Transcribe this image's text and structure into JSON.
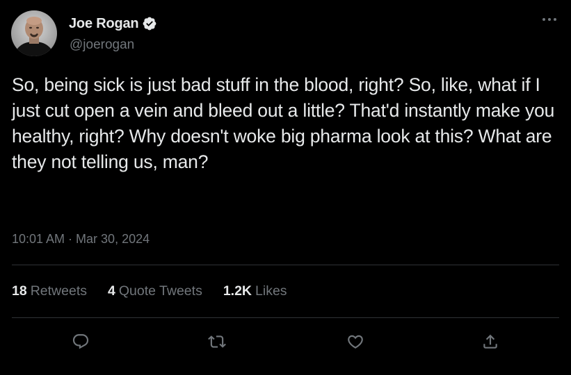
{
  "author": {
    "display_name": "Joe Rogan",
    "handle": "@joerogan",
    "verified": true
  },
  "tweet": {
    "text": "So, being sick is just bad stuff in the blood, right? So, like, what if I just cut open a vein and bleed out a little? That'd instantly make you healthy, right? Why doesn't woke big pharma look at this? What are they not telling us, man?",
    "timestamp": "10:01 AM · Mar 30, 2024"
  },
  "stats": {
    "retweets_count": "18",
    "retweets_label": "Retweets",
    "quote_tweets_count": "4",
    "quote_tweets_label": "Quote Tweets",
    "likes_count": "1.2K",
    "likes_label": "Likes"
  },
  "actions": {
    "reply_icon": "reply-icon",
    "retweet_icon": "retweet-icon",
    "like_icon": "heart-icon",
    "share_icon": "share-icon"
  },
  "colors": {
    "background": "#000000",
    "primary_text": "#e7e9ea",
    "secondary_text": "#71767b",
    "divider": "#2f3336"
  }
}
